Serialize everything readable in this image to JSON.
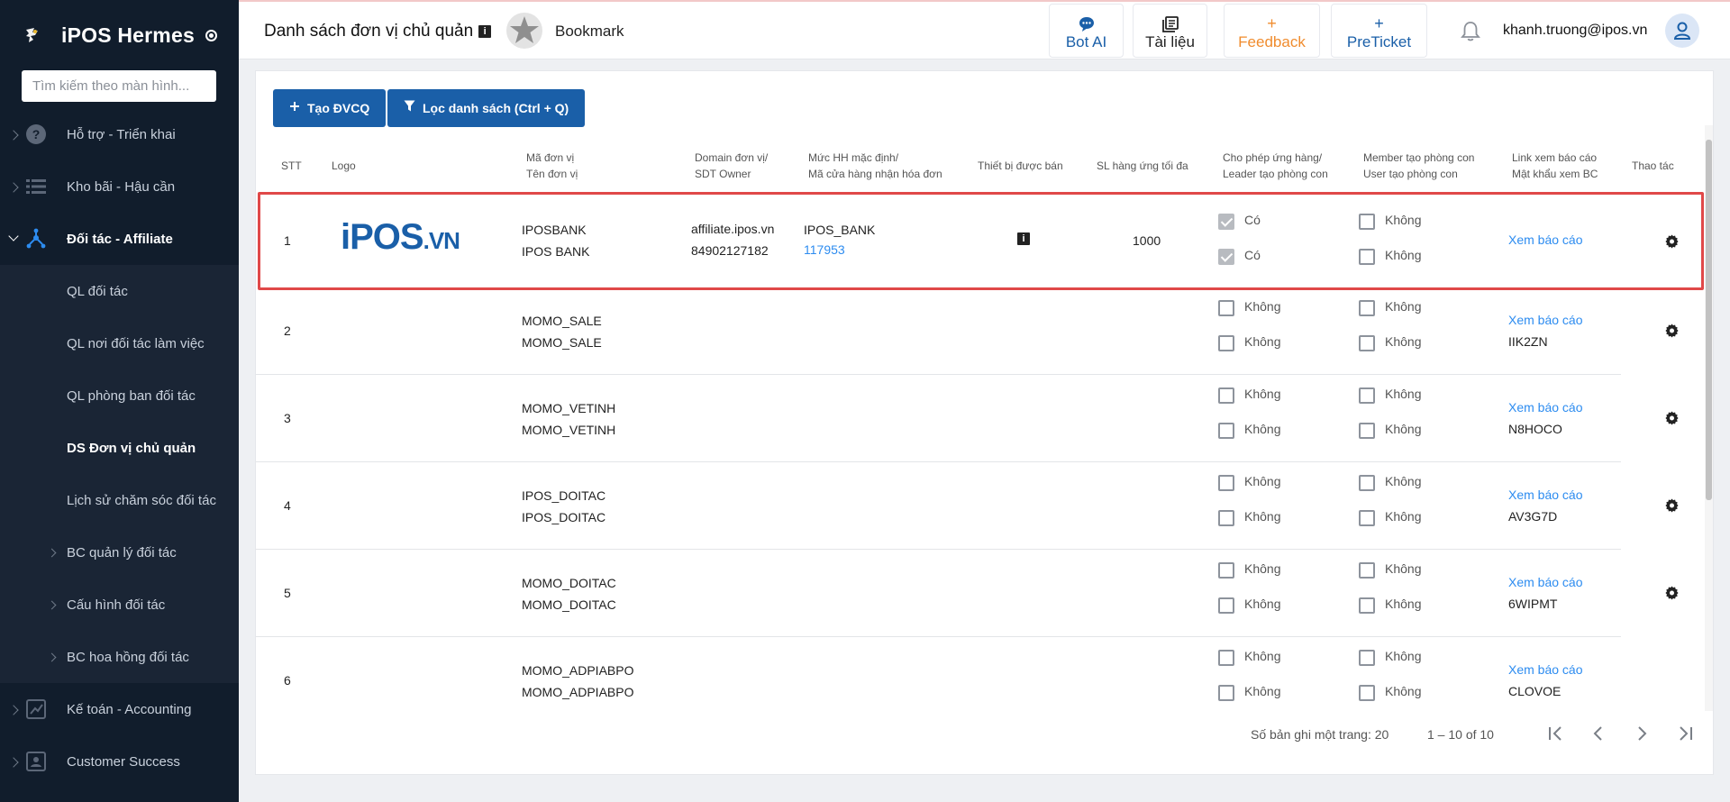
{
  "app": {
    "name": "iPOS Hermes",
    "search_placeholder": "Tìm kiếm theo màn hình..."
  },
  "sidebar": {
    "items": [
      {
        "label": "Hỗ trợ - Triển khai",
        "icon": "help-circle-icon"
      },
      {
        "label": "Kho bãi - Hậu cần",
        "icon": "list-icon"
      },
      {
        "label": "Đối tác - Affiliate",
        "icon": "network-icon"
      },
      {
        "label": "Kế toán - Accounting",
        "icon": "accounting-icon"
      },
      {
        "label": "Customer Success",
        "icon": "contact-card-icon"
      }
    ],
    "sub_items": [
      {
        "label": "QL đối tác"
      },
      {
        "label": "QL nơi đối tác làm việc"
      },
      {
        "label": "QL phòng ban đối tác"
      },
      {
        "label": "DS Đơn vị chủ quản"
      },
      {
        "label": "Lịch sử chăm sóc đối tác"
      },
      {
        "label": "BC quản lý đối tác"
      },
      {
        "label": "Cấu hình đối tác"
      },
      {
        "label": "BC hoa hồng đối tác"
      }
    ]
  },
  "header": {
    "title": "Danh sách đơn vị chủ quản",
    "info_icon": "i",
    "bookmark": "Bookmark",
    "buttons": {
      "bot_ai": "Bot AI",
      "tai_lieu": "Tài liệu",
      "feedback": "Feedback",
      "preticket": "PreTicket"
    },
    "plus": "+",
    "user_email": "khanh.truong@ipos.vn"
  },
  "toolbar": {
    "create_label": "Tạo ĐVCQ",
    "filter_label": "Lọc danh sách (Ctrl + Q)"
  },
  "table": {
    "headers": {
      "stt": "STT",
      "logo": "Logo",
      "code_1": "Mã đơn vị",
      "code_2": "Tên đơn vị",
      "domain_1": "Domain đơn vị/",
      "domain_2": "SDT Owner",
      "level_1": "Mức HH mặc định/",
      "level_2": "Mã cửa hàng nhận hóa đơn",
      "device": "Thiết bị được bán",
      "qty": "SL hàng ứng tối đa",
      "allow_1": "Cho phép ứng hàng/",
      "allow_2": "Leader tạo phòng con",
      "member_1": "Member tạo phòng con",
      "member_2": "User tạo phòng con",
      "link_1": "Link xem báo cáo",
      "link_2": "Mật khẩu xem BC",
      "action": "Thao tác"
    },
    "rows": [
      {
        "stt": "1",
        "code": "IPOSBANK",
        "name": "IPOS BANK",
        "domain": "affiliate.ipos.vn",
        "phone": "84902127182",
        "level": "IPOS_BANK",
        "store_code": "117953",
        "device_icon": "i",
        "qty": "1000",
        "allow": "Có",
        "leader": "Có",
        "member": "Không",
        "user": "Không",
        "link": "Xem báo cáo",
        "password": "",
        "logo_text_a": "iPOS",
        "logo_text_b": ".VN"
      },
      {
        "stt": "2",
        "code": "MOMO_SALE",
        "name": "MOMO_SALE",
        "allow": "Không",
        "leader": "Không",
        "member": "Không",
        "user": "Không",
        "link": "Xem báo cáo",
        "password": "IIK2ZN"
      },
      {
        "stt": "3",
        "code": "MOMO_VETINH",
        "name": "MOMO_VETINH",
        "allow": "Không",
        "leader": "Không",
        "member": "Không",
        "user": "Không",
        "link": "Xem báo cáo",
        "password": "N8HOCO"
      },
      {
        "stt": "4",
        "code": "IPOS_DOITAC",
        "name": "IPOS_DOITAC",
        "allow": "Không",
        "leader": "Không",
        "member": "Không",
        "user": "Không",
        "link": "Xem báo cáo",
        "password": "AV3G7D"
      },
      {
        "stt": "5",
        "code": "MOMO_DOITAC",
        "name": "MOMO_DOITAC",
        "allow": "Không",
        "leader": "Không",
        "member": "Không",
        "user": "Không",
        "link": "Xem báo cáo",
        "password": "6WIPMT"
      },
      {
        "stt": "6",
        "code": "MOMO_ADPIABPO",
        "name": "MOMO_ADPIABPO",
        "allow": "Không",
        "leader": "Không",
        "member": "Không",
        "user": "Không",
        "link": "Xem báo cáo",
        "password": "CLOVOE"
      }
    ]
  },
  "pagination": {
    "page_size_label": "Số bản ghi một trang: 20",
    "range_label": "1 – 10 of 10"
  },
  "colors": {
    "sidebar_bg": "#111d2c",
    "primary": "#1a5fa8",
    "link": "#2d8cf0",
    "feedback": "#f08c2e",
    "highlight": "#e04848"
  }
}
